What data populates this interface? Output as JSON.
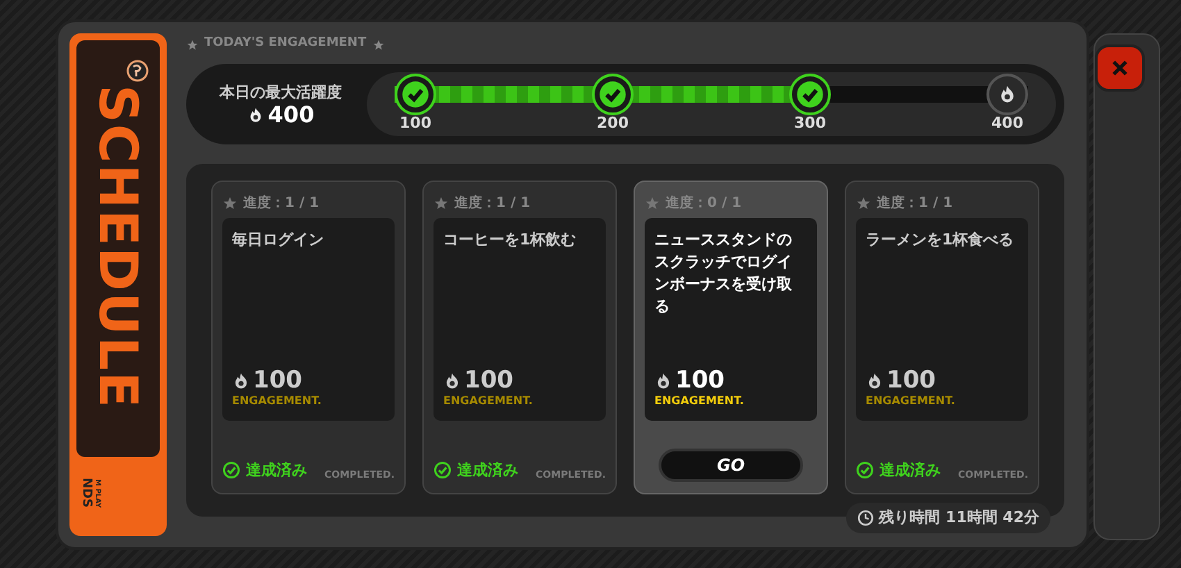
{
  "side_tab": {
    "title": "SCHEDULE",
    "footer": "NDS",
    "footer_sub": "M PLAY"
  },
  "header": "TODAY'S ENGAGEMENT",
  "summary": {
    "label": "本日の最大活躍度",
    "value": "400"
  },
  "progress": {
    "level": 0.67,
    "milestones": [
      {
        "label": "100",
        "done": true
      },
      {
        "label": "200",
        "done": true
      },
      {
        "label": "300",
        "done": true
      },
      {
        "label": "400",
        "done": false
      }
    ]
  },
  "missions": [
    {
      "progress": "進度：1 / 1",
      "title": "毎日ログイン",
      "points": "100",
      "unit": "ENGAGEMENT.",
      "kind": "completed",
      "status": "達成済み",
      "status_sub": "COMPLETED.",
      "selected": false
    },
    {
      "progress": "進度：1 / 1",
      "title": "コーヒーを1杯飲む",
      "points": "100",
      "unit": "ENGAGEMENT.",
      "kind": "completed",
      "status": "達成済み",
      "status_sub": "COMPLETED.",
      "selected": false
    },
    {
      "progress": "進度：0 / 1",
      "title": "ニューススタンドのスクラッチでログインボーナスを受け取る",
      "points": "100",
      "unit": "ENGAGEMENT.",
      "kind": "go",
      "status": "GO",
      "selected": true
    },
    {
      "progress": "進度：1 / 1",
      "title": "ラーメンを1杯食べる",
      "points": "100",
      "unit": "ENGAGEMENT.",
      "kind": "completed",
      "status": "達成済み",
      "status_sub": "COMPLETED.",
      "selected": false
    }
  ],
  "timer": "残り時間 11時間 42分"
}
